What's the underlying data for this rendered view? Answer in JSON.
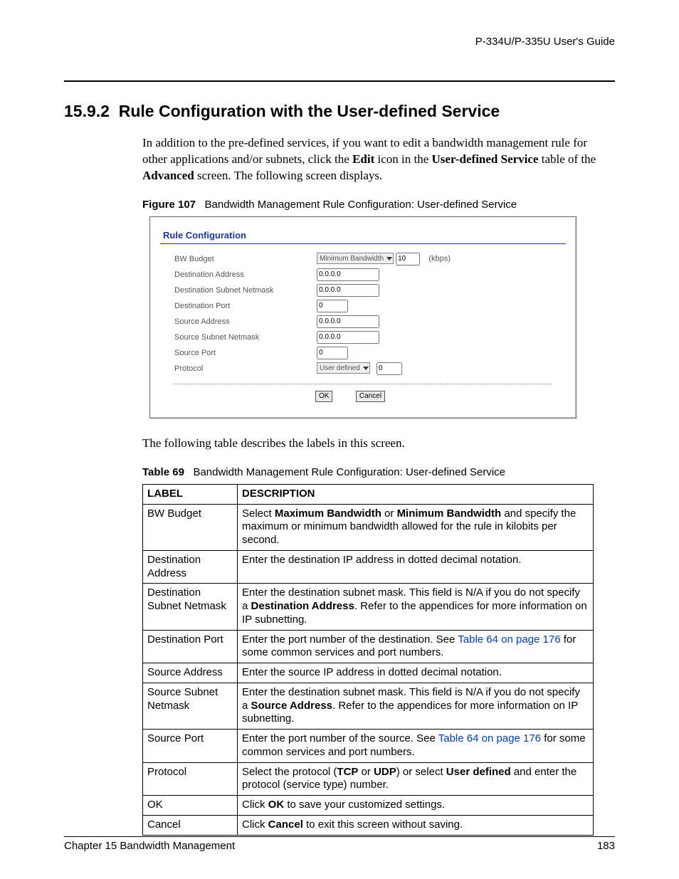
{
  "header": {
    "guide_title": "P-334U/P-335U User's Guide"
  },
  "section": {
    "number": "15.9.2",
    "title": "Rule Configuration with the User-defined Service"
  },
  "intro_para_html": "In addition to the pre-defined services, if you want to edit a bandwidth management rule for other applications and/or subnets, click the <b>Edit</b> icon in the <b>User-defined Service</b> table of the <b>Advanced</b> screen. The following screen displays.",
  "figure": {
    "label": "Figure 107",
    "title": "Bandwidth Management Rule Configuration: User-defined Service",
    "panel_title": "Rule Configuration",
    "bw_budget": {
      "label": "BW Budget",
      "select": "Minimum Bandwidth",
      "value": "10",
      "unit": "(kbps)"
    },
    "dest_addr": {
      "label": "Destination Address",
      "value": "0.0.0.0"
    },
    "dest_mask": {
      "label": "Destination Subnet Netmask",
      "value": "0.0.0.0"
    },
    "dest_port": {
      "label": "Destination Port",
      "value": "0"
    },
    "src_addr": {
      "label": "Source Address",
      "value": "0.0.0.0"
    },
    "src_mask": {
      "label": "Source Subnet Netmask",
      "value": "0.0.0.0"
    },
    "src_port": {
      "label": "Source Port",
      "value": "0"
    },
    "protocol": {
      "label": "Protocol",
      "select": "User defined",
      "value": "0"
    },
    "buttons": {
      "ok": "OK",
      "cancel": "Cancel"
    }
  },
  "mid_para": "The following table describes the labels in this screen.",
  "table": {
    "label": "Table 69",
    "title": "Bandwidth Management Rule Configuration: User-defined Service",
    "head_label": "LABEL",
    "head_desc": "DESCRIPTION",
    "rows": [
      {
        "label": "BW Budget",
        "desc_html": "Select <b>Maximum Bandwidth</b> or <b>Minimum Bandwidth</b> and specify the maximum or minimum bandwidth allowed for the rule in kilobits per second."
      },
      {
        "label": "Destination Address",
        "desc_html": "Enter the destination IP address in dotted decimal notation."
      },
      {
        "label": "Destination Subnet Netmask",
        "desc_html": "Enter the destination subnet mask. This field is N/A if you do not specify a <b>Destination Address</b>. Refer to the appendices for more information on IP subnetting."
      },
      {
        "label": "Destination Port",
        "desc_html": "Enter the port number of the destination. See <span class=\"linkref\">Table 64 on page 176</span> for some common services and port numbers."
      },
      {
        "label": "Source Address",
        "desc_html": "Enter the source IP address in dotted decimal notation."
      },
      {
        "label": "Source Subnet Netmask",
        "desc_html": "Enter the destination subnet mask. This field is N/A if you do not specify a <b>Source Address</b>. Refer to the appendices for more information on IP subnetting."
      },
      {
        "label": "Source Port",
        "desc_html": "Enter the port number of the source. See <span class=\"linkref\">Table 64 on page 176</span> for some common services and port numbers."
      },
      {
        "label": "Protocol",
        "desc_html": "Select the protocol (<b>TCP</b> or <b>UDP</b>) or select <b>User defined</b> and enter the protocol (service type) number."
      },
      {
        "label": "OK",
        "desc_html": "Click <b>OK</b> to save your customized settings."
      },
      {
        "label": "Cancel",
        "desc_html": "Click <b>Cancel</b> to exit this screen without saving."
      }
    ]
  },
  "footer": {
    "chapter": "Chapter 15 Bandwidth Management",
    "page": "183"
  }
}
